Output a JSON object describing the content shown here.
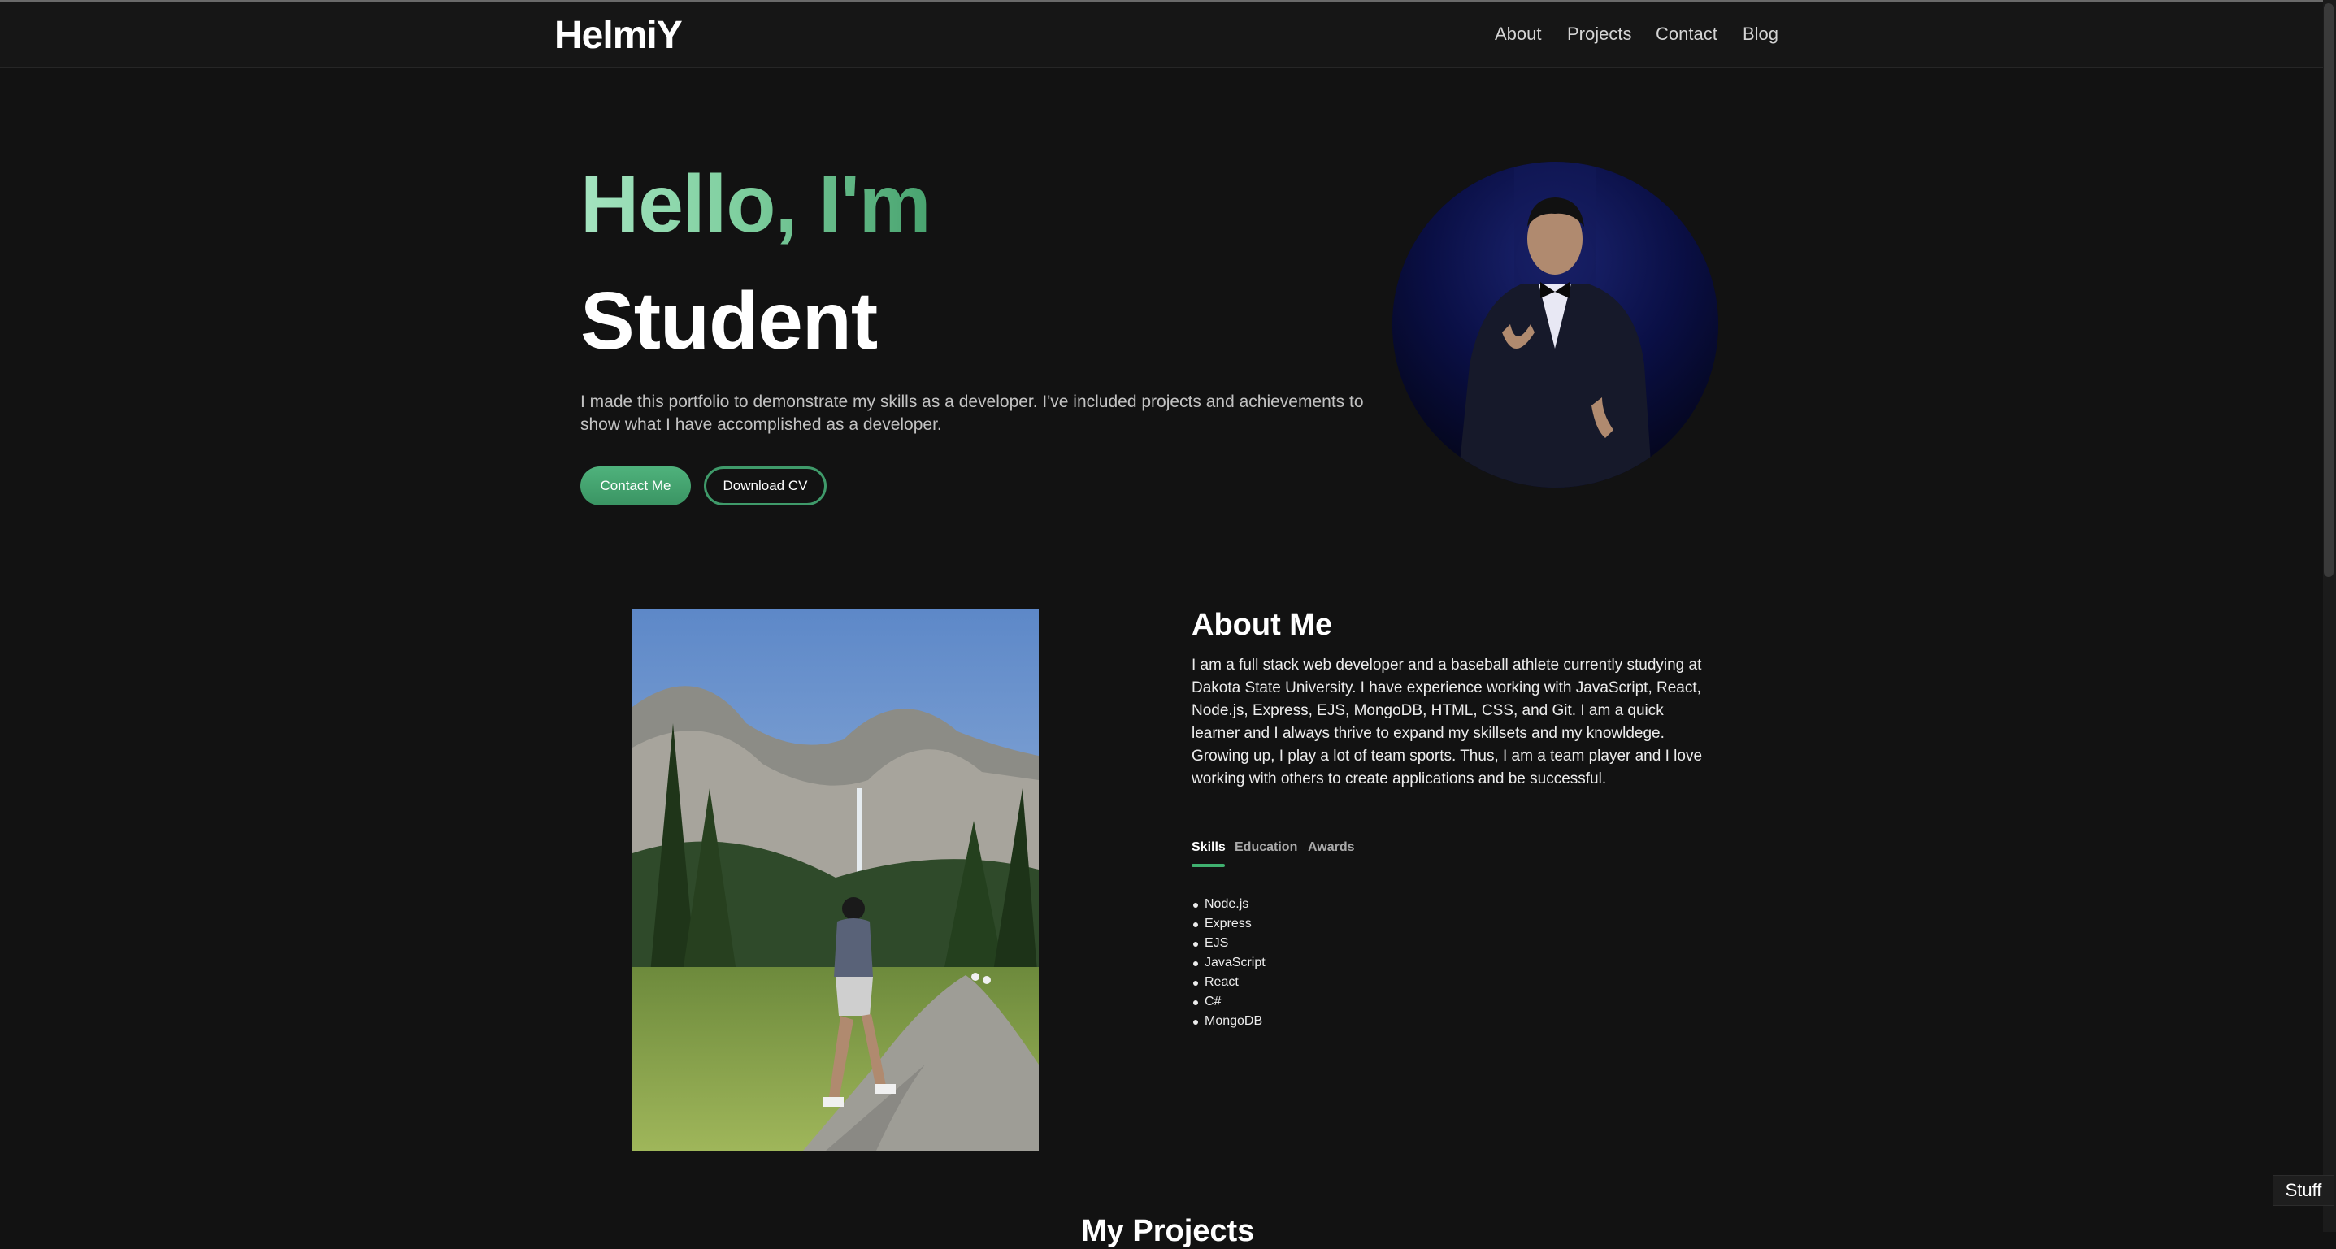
{
  "nav": {
    "logo": "HelmiY",
    "links": [
      "About",
      "Projects",
      "Contact",
      "Blog"
    ]
  },
  "hero": {
    "greeting": "Hello, I'm",
    "role": "Student",
    "description": "I made this portfolio to demonstrate my skills as a developer. I've included projects and achievements to show what I have accomplished as a developer.",
    "contact_button": "Contact Me",
    "cv_button": "Download CV"
  },
  "about": {
    "title": "About Me",
    "text": "I am a full stack web developer and a baseball athlete currently studying at Dakota State University. I have experience working with JavaScript, React, Node.js, Express, EJS, MongoDB, HTML, CSS, and Git. I am a quick learner and I always thrive to expand my skillsets and my knowldege. Growing up, I play a lot of team sports. Thus, I am a team player and I love working with others to create applications and be successful.",
    "tabs": [
      "Skills",
      "Education",
      "Awards"
    ],
    "active_tab": "Skills",
    "skills": [
      "Node.js",
      "Express",
      "EJS",
      "JavaScript",
      "React",
      "C#",
      "MongoDB"
    ]
  },
  "projects": {
    "title": "My Projects"
  },
  "widget": {
    "label": "Stuff"
  },
  "colors": {
    "background": "#121212",
    "accent": "#3fb06f",
    "accent_light": "#a4e4c0"
  }
}
